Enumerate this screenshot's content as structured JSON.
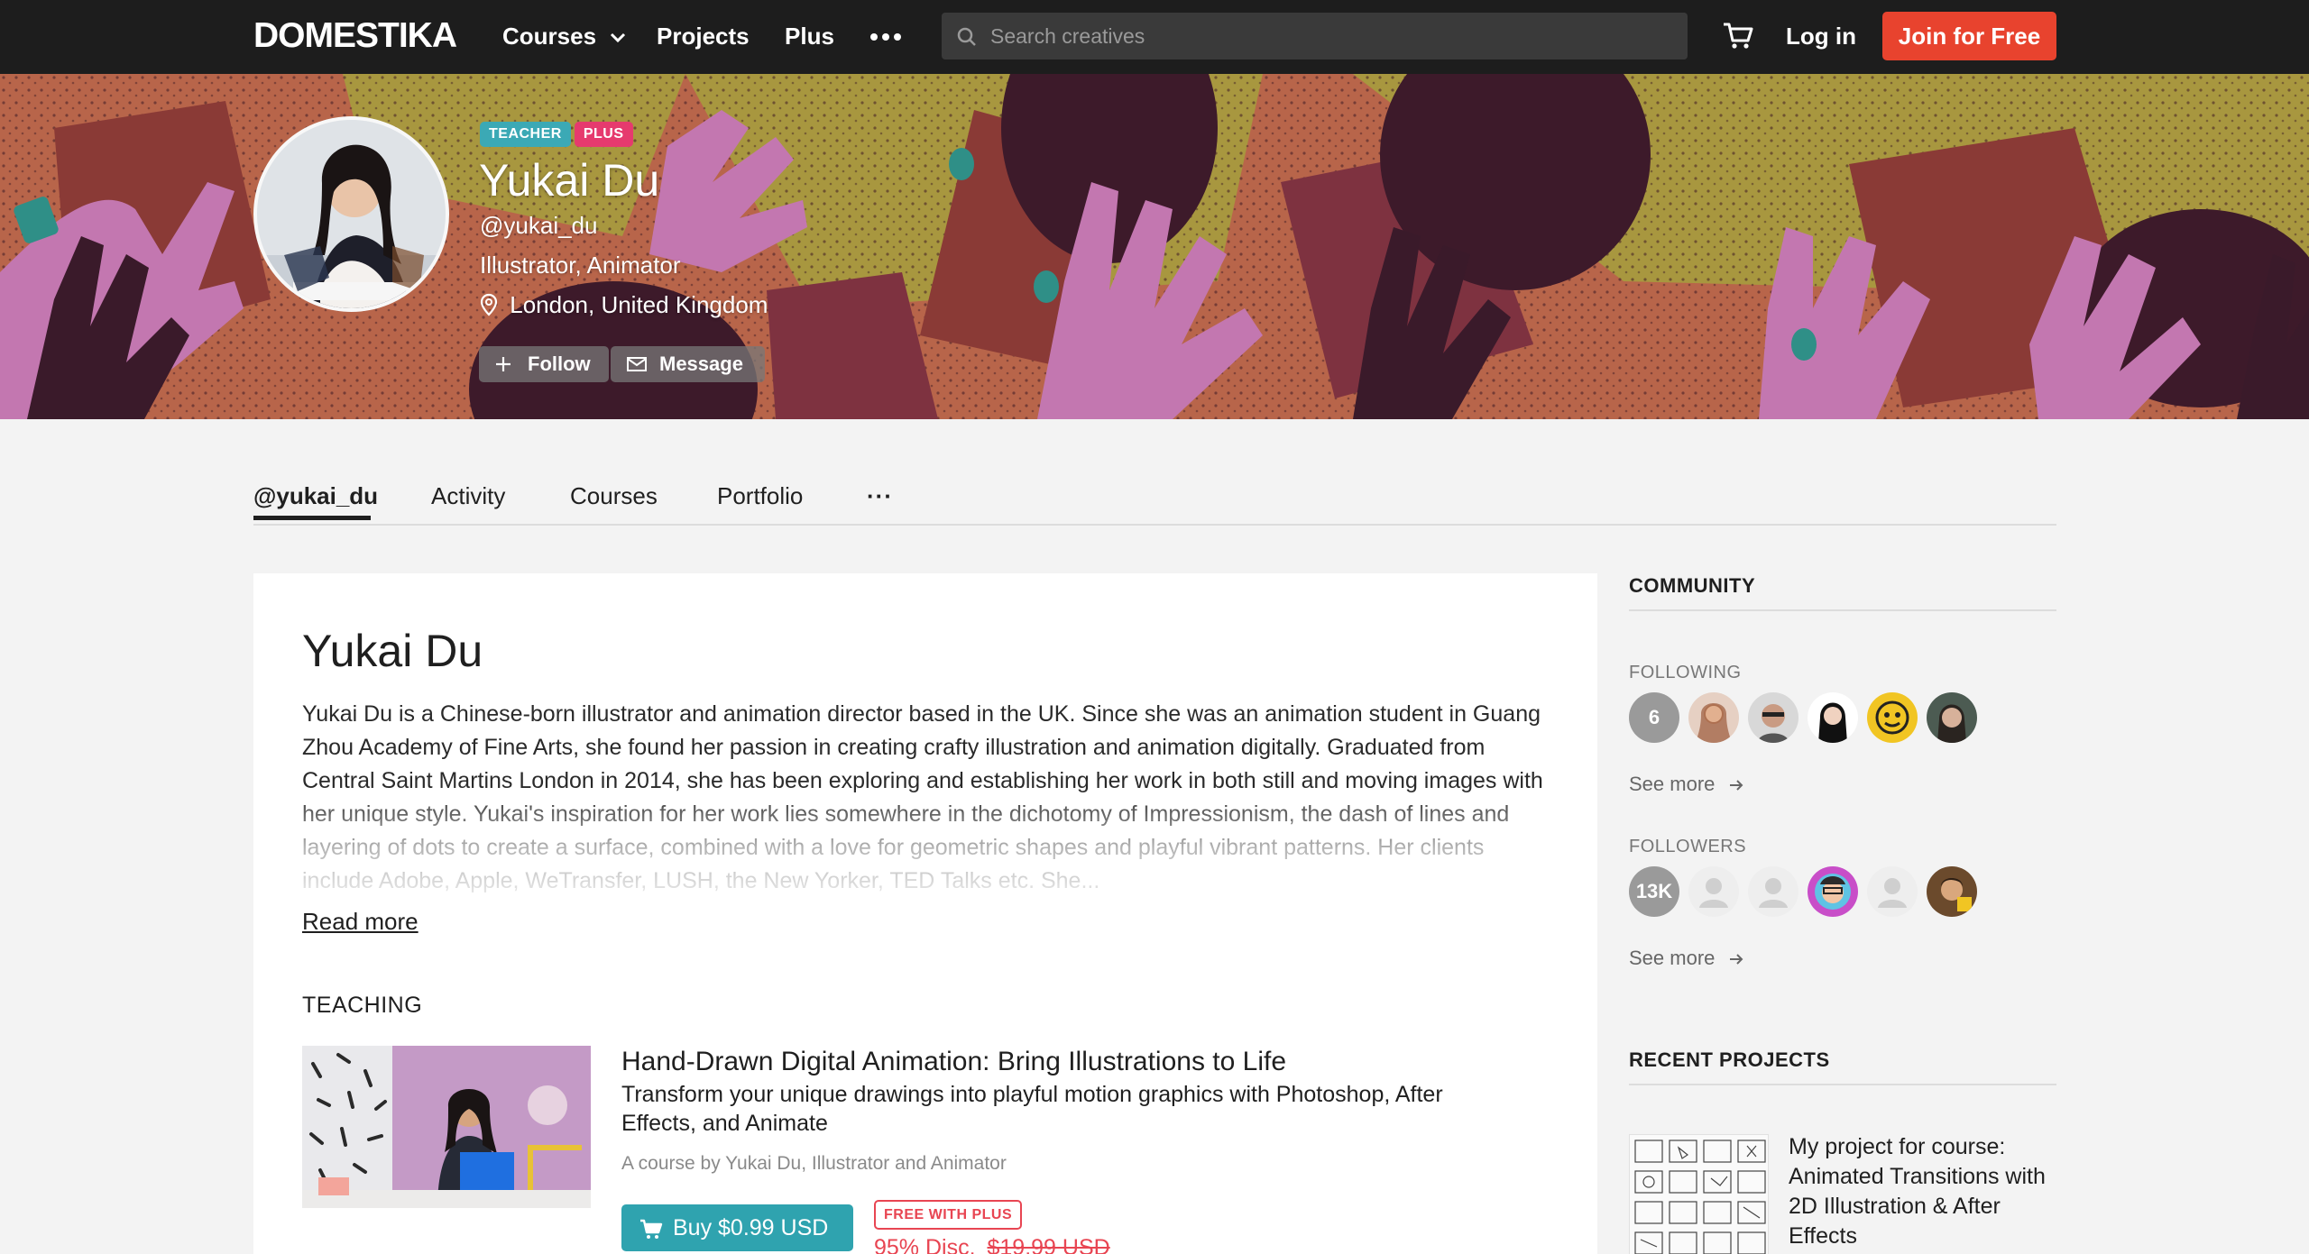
{
  "header": {
    "logo": "DOMESTIKA",
    "nav": {
      "courses": "Courses",
      "projects": "Projects",
      "plus": "Plus"
    },
    "search_placeholder": "Search creatives",
    "login": "Log in",
    "join": "Join for Free"
  },
  "profile": {
    "badges": {
      "teacher": "TEACHER",
      "plus": "PLUS"
    },
    "name": "Yukai Du",
    "username": "@yukai_du",
    "role": "Illustrator, Animator",
    "location": "London, United Kingdom",
    "follow_label": "Follow",
    "message_label": "Message"
  },
  "tabs": {
    "profile": "@yukai_du",
    "activity": "Activity",
    "courses": "Courses",
    "portfolio": "Portfolio",
    "more": "···"
  },
  "about": {
    "title": "Yukai Du",
    "bio": "Yukai Du is a Chinese-born illustrator and animation director based in the UK. Since she was an animation student in Guang Zhou Academy of Fine Arts, she found her passion in creating crafty illustration and animation digitally. Graduated from Central Saint Martins London in 2014, she has been exploring and establishing her work in both still and moving images with her unique style. Yukai's inspiration for her work lies somewhere in the dichotomy of Impressionism, the dash of lines and layering of dots to create a surface, combined with a love for geometric shapes and playful vibrant patterns. Her clients include Adobe, Apple, WeTransfer, LUSH, the New Yorker, TED Talks etc. She...",
    "read_more": "Read more"
  },
  "teaching": {
    "heading": "TEACHING",
    "course": {
      "title": "Hand-Drawn Digital Animation: Bring Illustrations to Life",
      "description": "Transform your unique drawings into playful motion graphics with Photoshop, After Effects, and Animate",
      "byline": "A course by Yukai Du, Illustrator and Animator",
      "buy_label": "Buy $0.99 USD",
      "plus_badge": "FREE WITH PLUS",
      "discount": "95% Disc.",
      "original_price": "$19.99 USD"
    }
  },
  "community": {
    "heading": "COMMUNITY",
    "following_label": "FOLLOWING",
    "following_count": "6",
    "followers_label": "FOLLOWERS",
    "followers_count": "13K",
    "see_more": "See more"
  },
  "recent_projects": {
    "heading": "RECENT PROJECTS",
    "items": [
      {
        "title": "My project for course: Animated Transitions with 2D Illustration & After Effects"
      }
    ]
  },
  "colors": {
    "accent_join": "#e8432e",
    "accent_teal": "#2fa3af",
    "badge_plus": "#e63a6e",
    "discount_red": "#e84552"
  }
}
